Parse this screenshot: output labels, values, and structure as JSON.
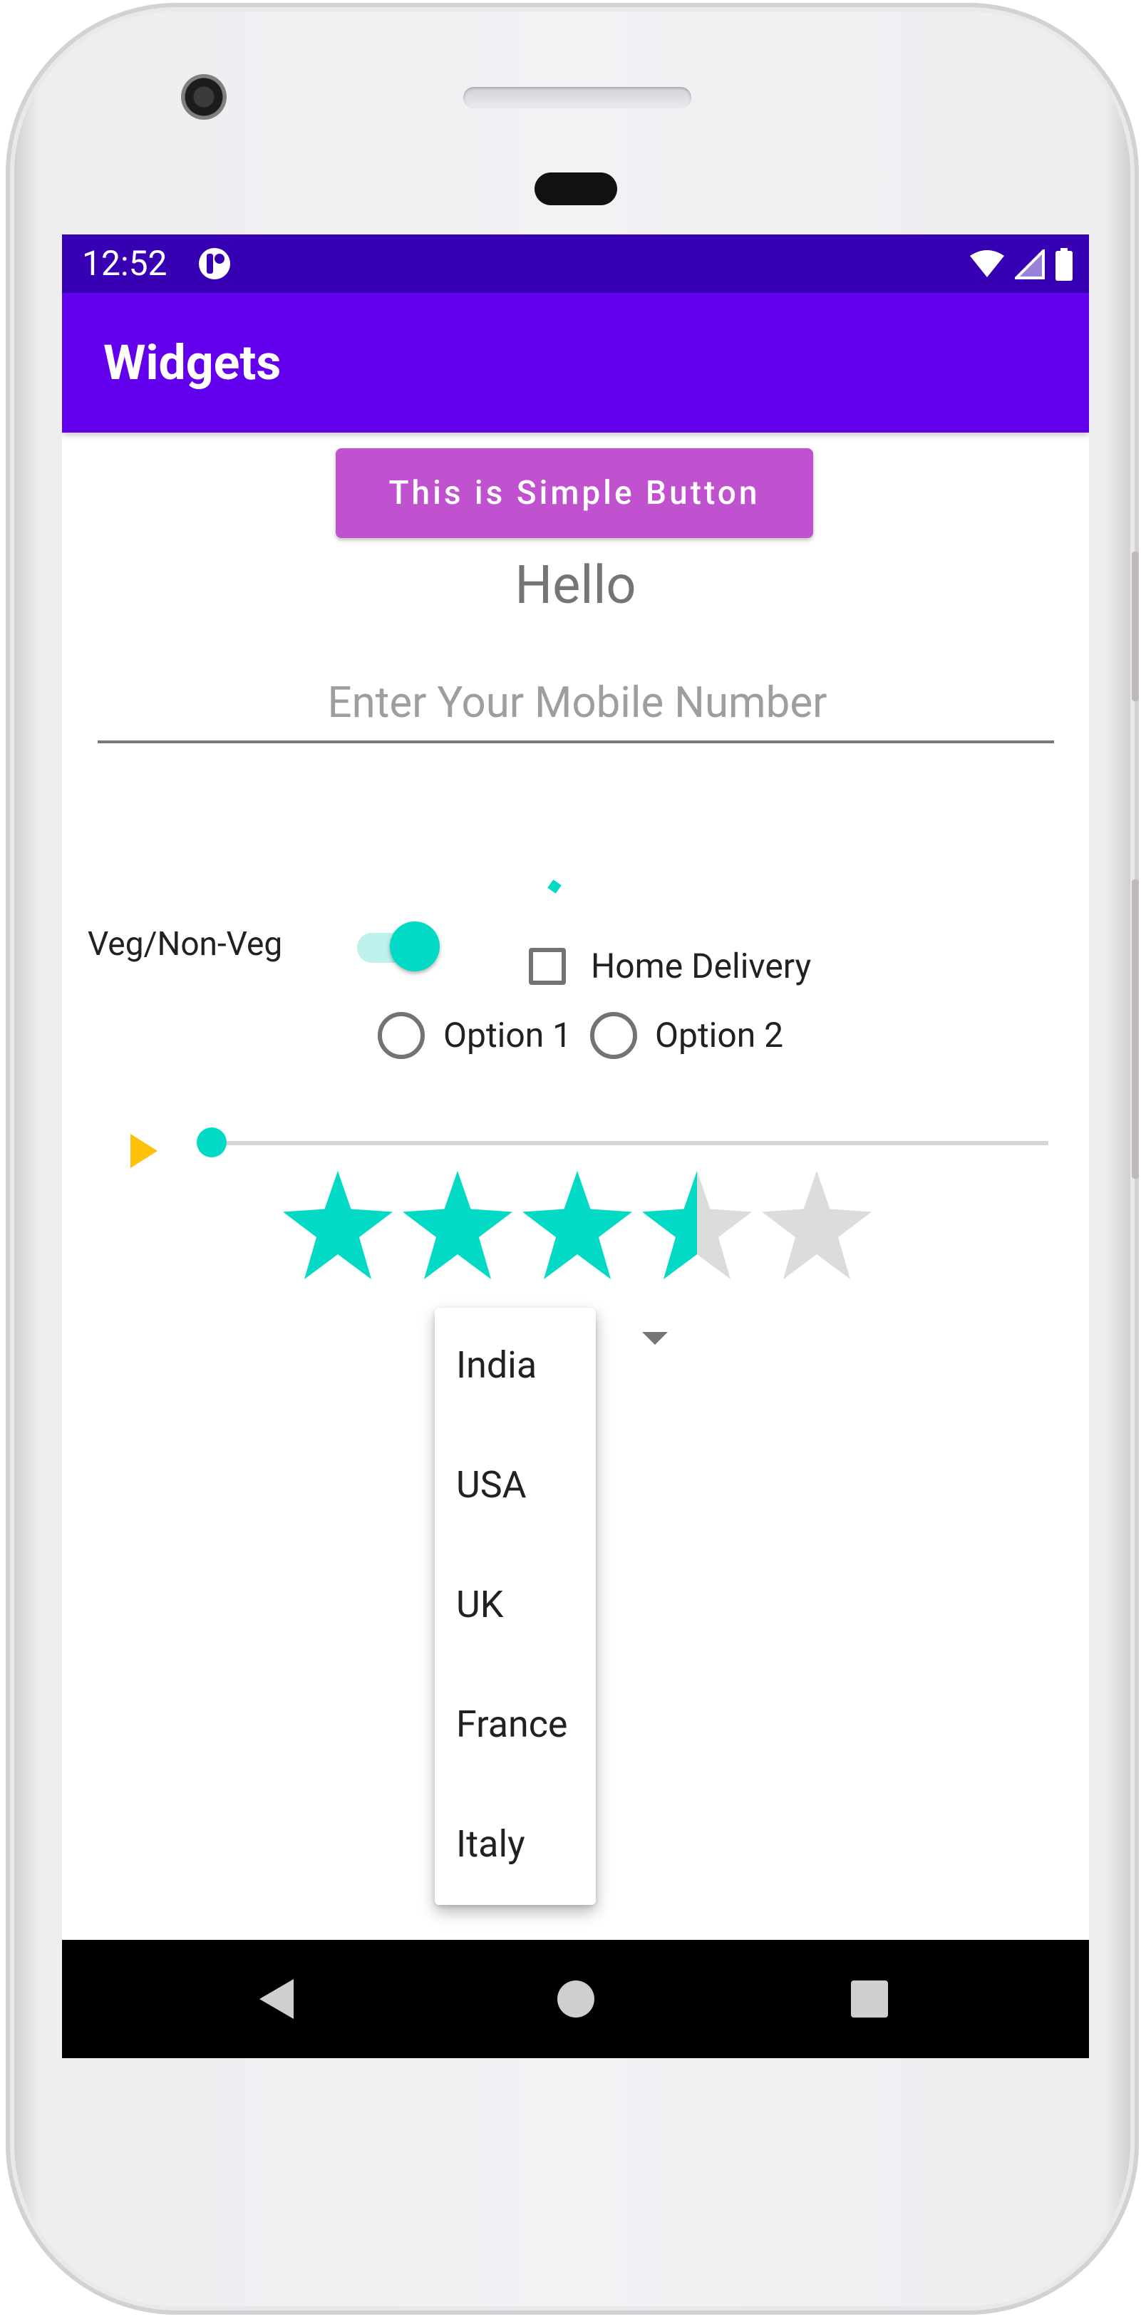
{
  "status_bar": {
    "time": "12:52",
    "icons": [
      "app-notification-icon",
      "wifi-icon",
      "signal-icon",
      "battery-icon"
    ]
  },
  "app_bar": {
    "title": "Widgets"
  },
  "content": {
    "simple_button_label": "This is Simple Button",
    "hello_text": "Hello",
    "mobile_input": {
      "value": "",
      "placeholder": "Enter Your Mobile Number"
    },
    "veg_switch": {
      "label": "Veg/Non-Veg",
      "checked": true
    },
    "home_delivery": {
      "label": "Home Delivery",
      "checked": false
    },
    "radio_options": [
      {
        "label": "Option 1",
        "selected": false
      },
      {
        "label": "Option 2",
        "selected": false
      }
    ],
    "seek_bar": {
      "progress": 0
    },
    "rating": {
      "value": 3.5,
      "max": 5
    },
    "spinner": {
      "options": [
        "India",
        "USA",
        "UK",
        "France",
        "Italy"
      ]
    }
  },
  "nav_bar": {
    "icons": [
      "back-icon",
      "home-icon",
      "recents-icon"
    ]
  },
  "colors": {
    "status_bar": "#3700b3",
    "app_bar": "#6200ee",
    "button": "#c052d0",
    "accent": "#03dac5",
    "seek_marker": "#ffc107"
  }
}
